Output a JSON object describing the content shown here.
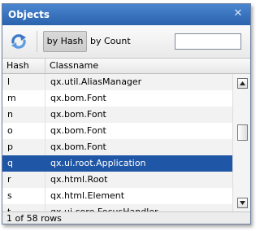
{
  "window": {
    "title": "Objects",
    "close_glyph": "✕"
  },
  "toolbar": {
    "reload_icon": "reload-icon",
    "tab_hash_label": "by Hash",
    "tab_count_label": "by Count",
    "filter": {
      "value": "",
      "placeholder": ""
    }
  },
  "grid": {
    "columns": [
      "Hash",
      "Classname"
    ],
    "rows": [
      {
        "hash": "l",
        "classname": "qx.util.AliasManager"
      },
      {
        "hash": "m",
        "classname": "qx.bom.Font"
      },
      {
        "hash": "n",
        "classname": "qx.bom.Font"
      },
      {
        "hash": "o",
        "classname": "qx.bom.Font"
      },
      {
        "hash": "p",
        "classname": "qx.bom.Font"
      },
      {
        "hash": "q",
        "classname": "qx.ui.root.Application",
        "selected": true
      },
      {
        "hash": "r",
        "classname": "qx.html.Root"
      },
      {
        "hash": "s",
        "classname": "qx.html.Element"
      },
      {
        "hash": "t",
        "classname": "qx.ui.core.FocusHandler"
      }
    ]
  },
  "status": {
    "text": "1 of 58 rows"
  },
  "colors": {
    "title_bar": "#2b62ad",
    "selection": "#1f56a5"
  }
}
